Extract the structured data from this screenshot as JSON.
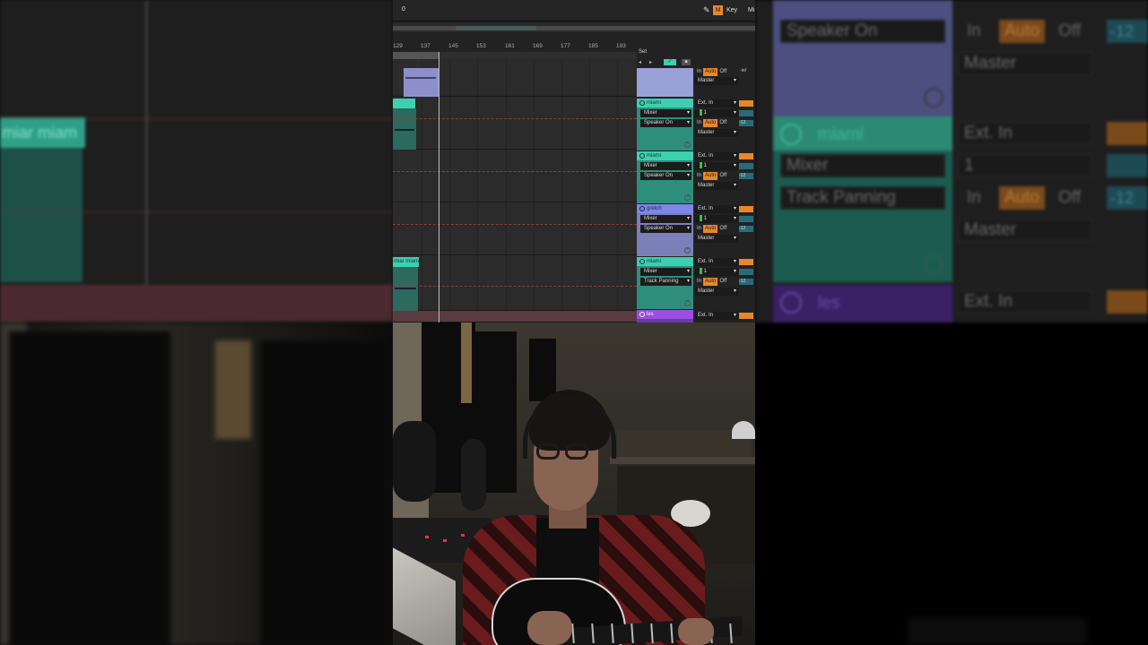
{
  "transport": {
    "position": "0",
    "key_label": "Key",
    "midi_label": "Mi",
    "midi_button": "M"
  },
  "ruler": {
    "bars": [
      "129",
      "137",
      "145",
      "153",
      "161",
      "169",
      "177",
      "185",
      "193"
    ]
  },
  "session": {
    "set_label": "Set"
  },
  "clips": {
    "miami_1": "",
    "miami_2": "miar miam"
  },
  "tracks": [
    {
      "name": "",
      "color": "#9aa0d8",
      "monitor_routing": "",
      "output": "Master",
      "input": "",
      "channel": "",
      "monitor": {
        "in": "In",
        "auto": "Auto",
        "off": "Off"
      },
      "volume": "-inf"
    },
    {
      "name": "miami",
      "color": "#3ecfb0",
      "input_type": "Mixer",
      "output_type": "Speaker On",
      "input": "Ext. In",
      "channel": "1",
      "monitor": {
        "in": "In",
        "auto": "Auto",
        "off": "Off"
      },
      "output": "Master",
      "volume": "-12"
    },
    {
      "name": "miami",
      "color": "#3ecfb0",
      "input_type": "Mixer",
      "output_type": "Speaker On",
      "input": "Ext. In",
      "channel": "1",
      "monitor": {
        "in": "In",
        "auto": "Auto",
        "off": "Off"
      },
      "output": "Master",
      "volume": "-12"
    },
    {
      "name": "gretch",
      "color": "#7d87e6",
      "input_type": "Mixer",
      "output_type": "Speaker On",
      "input": "Ext. In",
      "channel": "1",
      "monitor": {
        "in": "In",
        "auto": "Auto",
        "off": "Off"
      },
      "output": "Master",
      "volume": "-12"
    },
    {
      "name": "miami",
      "color": "#3ecfb0",
      "input_type": "Mixer",
      "output_type": "Track Panning",
      "input": "Ext. In",
      "channel": "1",
      "monitor": {
        "in": "In",
        "auto": "Auto",
        "off": "Off"
      },
      "output": "Master",
      "volume": "-12"
    },
    {
      "name": "les",
      "color": "#9b4fe0",
      "input": "Ext. In"
    }
  ],
  "zoomed_panel": {
    "mixer": "Mixer",
    "speaker_on": "Speaker On",
    "in": "In",
    "auto": "Auto",
    "off": "Off",
    "vol": "-12",
    "master": "Master",
    "miami": "miami",
    "ext_in": "Ext. In",
    "channel": "1",
    "track_panning": "Track Panning",
    "master2": "Master",
    "les": "les",
    "ext_in2": "Ext. In"
  },
  "colors": {
    "accent_orange": "#e8872a",
    "teal": "#3ecfb0",
    "purple": "#9b4fe0",
    "periwinkle": "#7d87e6"
  }
}
